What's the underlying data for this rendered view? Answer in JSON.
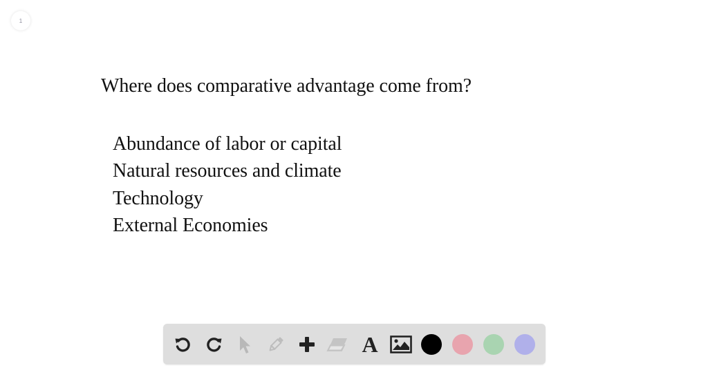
{
  "page_badge": {
    "number": "1"
  },
  "slide": {
    "question": "Where does comparative advantage come from?",
    "answers": [
      "Abundance of labor or capital",
      "Natural resources and climate",
      "Technology",
      "External Economies"
    ]
  },
  "toolbar": {
    "tools": [
      {
        "name": "undo",
        "icon": "undo-icon",
        "enabled": true
      },
      {
        "name": "redo",
        "icon": "redo-icon",
        "enabled": true
      },
      {
        "name": "select",
        "icon": "cursor-arrow-icon",
        "enabled": false
      },
      {
        "name": "pen",
        "icon": "pencil-icon",
        "enabled": false
      },
      {
        "name": "add",
        "icon": "plus-icon",
        "enabled": true
      },
      {
        "name": "eraser",
        "icon": "eraser-icon",
        "enabled": false
      },
      {
        "name": "text",
        "icon": "text-icon",
        "label": "A",
        "enabled": true
      },
      {
        "name": "image",
        "icon": "image-icon",
        "enabled": true
      }
    ],
    "colors": [
      {
        "name": "black",
        "hex": "#000000",
        "selected": true
      },
      {
        "name": "red",
        "hex": "#e8a4ae"
      },
      {
        "name": "green",
        "hex": "#a9d4b1"
      },
      {
        "name": "blue",
        "hex": "#b0b0ea"
      }
    ],
    "icon_active_color": "#222222",
    "icon_disabled_color": "#b8b8b8"
  }
}
